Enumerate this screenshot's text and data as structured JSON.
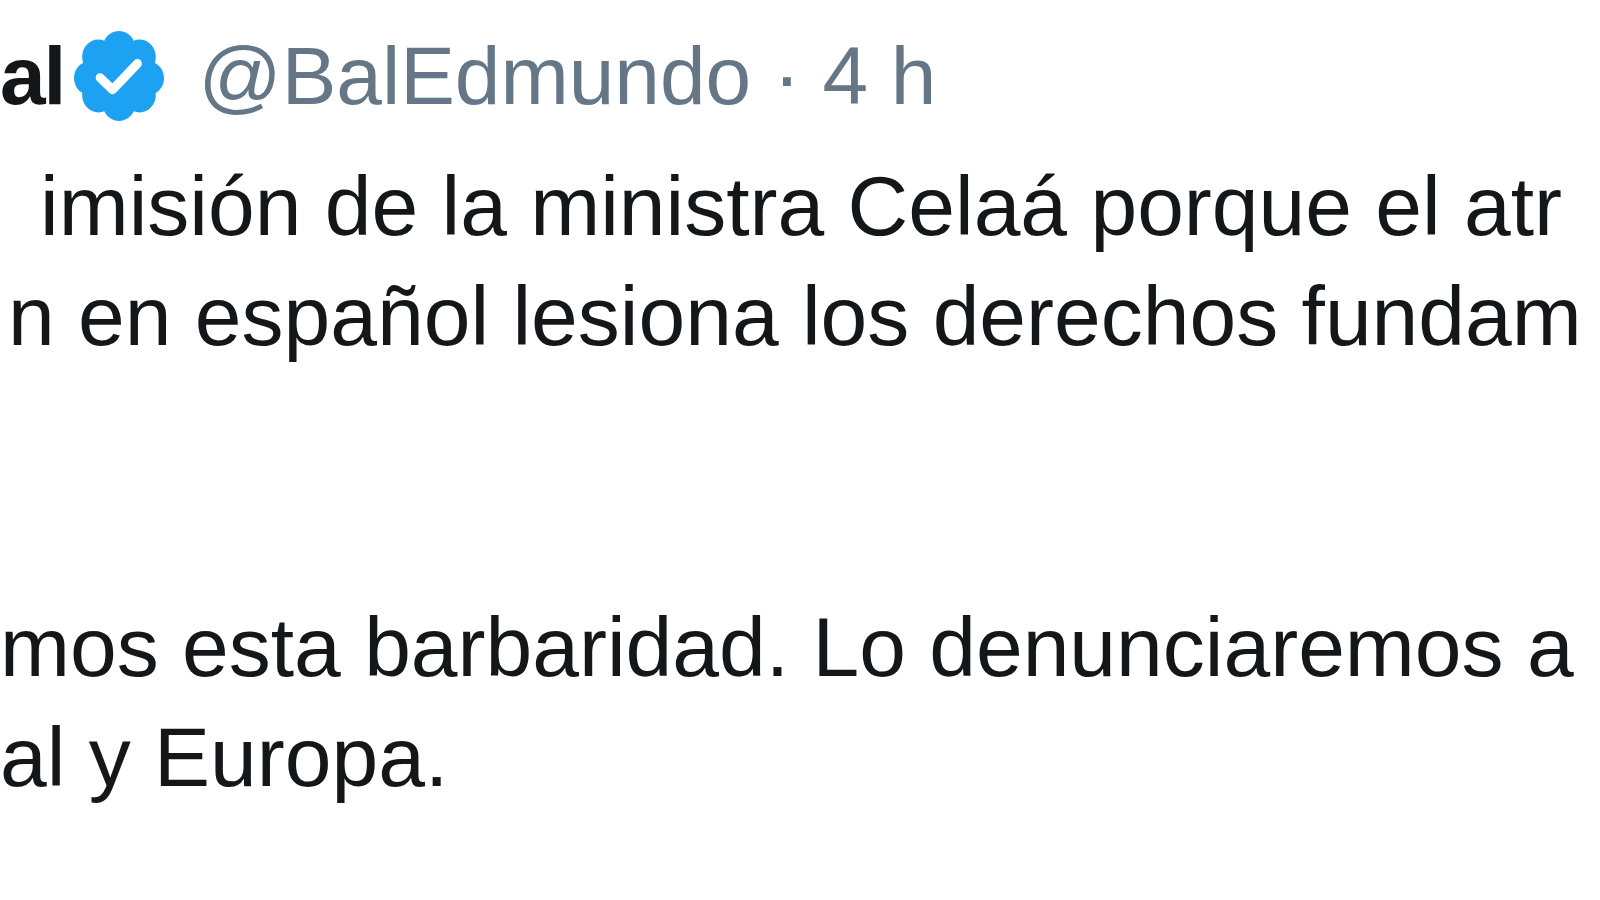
{
  "tweet": {
    "author_name": "al",
    "verified": true,
    "handle": "@BalEdmundo",
    "separator": "·",
    "time": "4 h",
    "paragraphs": [
      {
        "lines": [
          "imisión de la ministra Celaá porque el atr",
          "n en español lesiona los derechos fundam"
        ]
      },
      {
        "lines": [
          "mos esta barbaridad. Lo denunciaremos a",
          "al y Europa."
        ]
      }
    ]
  }
}
